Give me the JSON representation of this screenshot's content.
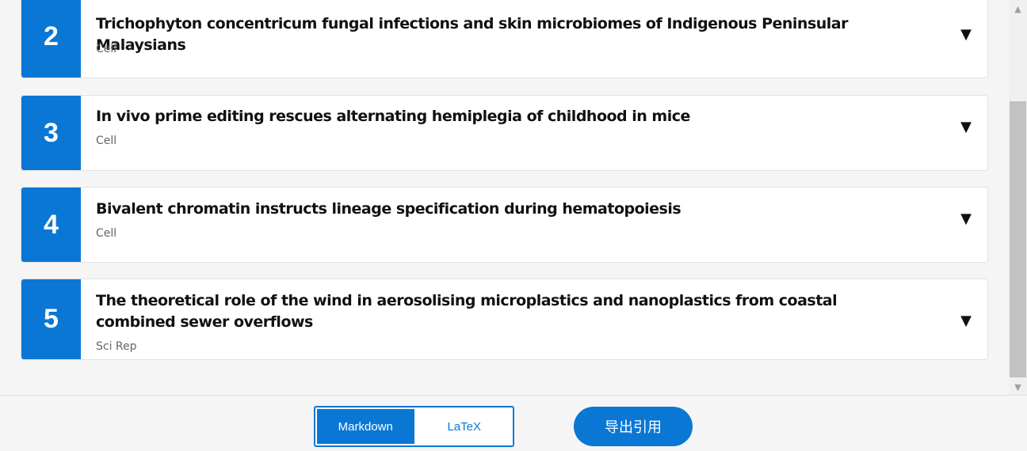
{
  "results": [
    {
      "number": "2",
      "title": "Trichophyton concentricum fungal infections and skin microbiomes of Indigenous Peninsular Malaysians",
      "journal": "Cell",
      "toggle_icon": "▼"
    },
    {
      "number": "3",
      "title": "In vivo prime editing rescues alternating hemiplegia of childhood in mice",
      "journal": "Cell",
      "toggle_icon": "▼"
    },
    {
      "number": "4",
      "title": "Bivalent chromatin instructs lineage specification during hematopoiesis",
      "journal": "Cell",
      "toggle_icon": "▼"
    },
    {
      "number": "5",
      "title": "The theoretical role of the wind in aerosolising microplastics and nanoplastics from coastal combined sewer overflows",
      "journal": "Sci Rep",
      "toggle_icon": "▼"
    }
  ],
  "footer": {
    "format_options": [
      "Markdown",
      "LaTeX"
    ],
    "selected_format": "Markdown",
    "export_label": "导出引用"
  },
  "scrollbar": {
    "up_arrow": "▲",
    "down_arrow": "▼"
  },
  "colors": {
    "accent": "#0a77d5",
    "card_bg": "#ffffff",
    "page_bg": "#f5f5f5"
  }
}
